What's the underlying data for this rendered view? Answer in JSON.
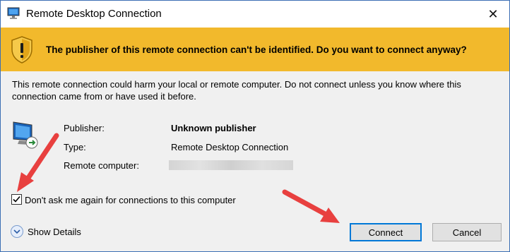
{
  "window": {
    "title": "Remote Desktop Connection",
    "close_glyph": "✕"
  },
  "banner": {
    "message": "The publisher of this remote connection can't be identified. Do you want to connect anyway?"
  },
  "warning": {
    "text": "This remote connection could harm your local or remote computer. Do not connect unless you know where this connection came from or have used it before."
  },
  "details": {
    "publisher_label": "Publisher:",
    "publisher_value": "Unknown publisher",
    "type_label": "Type:",
    "type_value": "Remote Desktop Connection",
    "remote_label": "Remote computer:",
    "remote_value_redacted": true
  },
  "checkbox": {
    "label": "Don't ask me again for connections to this computer",
    "checked": true
  },
  "footer": {
    "show_details_label": "Show Details",
    "connect_label": "Connect",
    "cancel_label": "Cancel"
  },
  "colors": {
    "banner": "#f2b92c",
    "accent": "#0078d7",
    "annotation_arrow": "#e8403f"
  }
}
